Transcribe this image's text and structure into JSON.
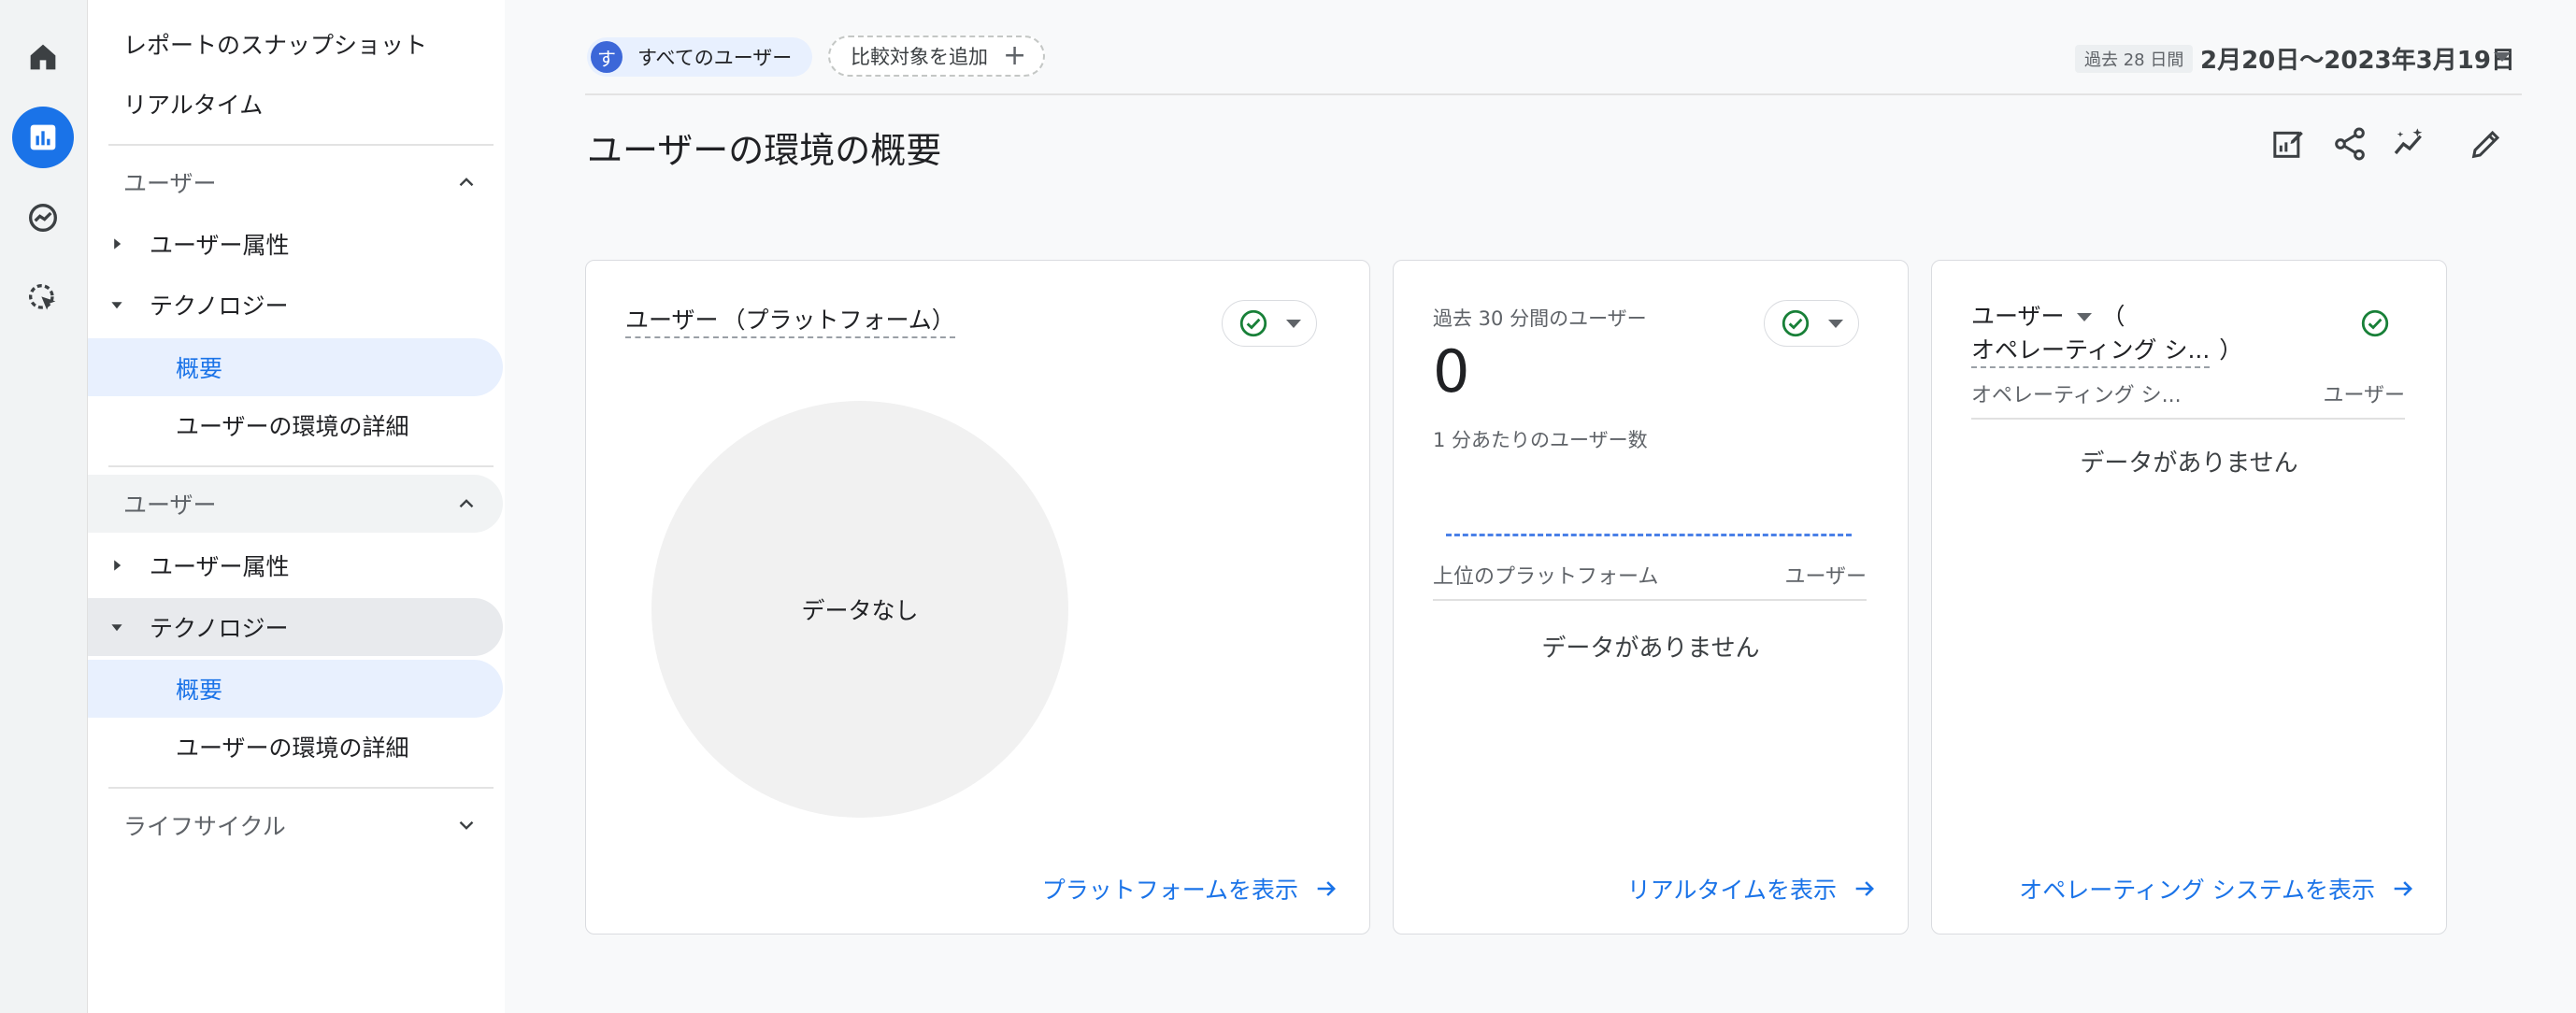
{
  "rail": {
    "icons": [
      "home-icon",
      "reports-icon",
      "explore-icon",
      "advertising-icon"
    ]
  },
  "sidebar": {
    "snapshot": "レポートのスナップショット",
    "realtime": "リアルタイム",
    "section1": {
      "title": "ユーザー",
      "items": [
        "ユーザー属性",
        "テクノロジー",
        "概要",
        "ユーザーの環境の詳細"
      ]
    },
    "section2": {
      "title": "ユーザー",
      "items": [
        "ユーザー属性",
        "テクノロジー",
        "概要",
        "ユーザーの環境の詳細"
      ]
    },
    "lifecycle": "ライフサイクル"
  },
  "header": {
    "all_users_avatar": "す",
    "all_users": "すべてのユーザー",
    "add_comparison": "比較対象を追加",
    "date_badge": "過去 28 日間",
    "date_range": "2月20日〜2023年3月19日",
    "title": "ユーザーの環境の概要"
  },
  "card1": {
    "title_part1": "ユーザー",
    "title_part2": "（プラットフォーム）",
    "nodata": "データなし",
    "link": "プラットフォームを表示"
  },
  "card2": {
    "title": "過去 30 分間のユーザー",
    "value": "0",
    "subtitle": "1 分あたりのユーザー数",
    "col1": "上位のプラットフォーム",
    "col2": "ユーザー",
    "nodata": "データがありません",
    "link": "リアルタイムを表示"
  },
  "card3": {
    "title_part1": "ユーザー",
    "title_paren_open": "（",
    "title_part2": "オペレーティング シ...",
    "title_paren_close": "）",
    "col1": "オペレーティング シ...",
    "col2": "ユーザー",
    "nodata": "データがありません",
    "link": "オペレーティング システムを表示"
  },
  "colors": {
    "accent": "#1a73e8",
    "check": "#188038"
  }
}
